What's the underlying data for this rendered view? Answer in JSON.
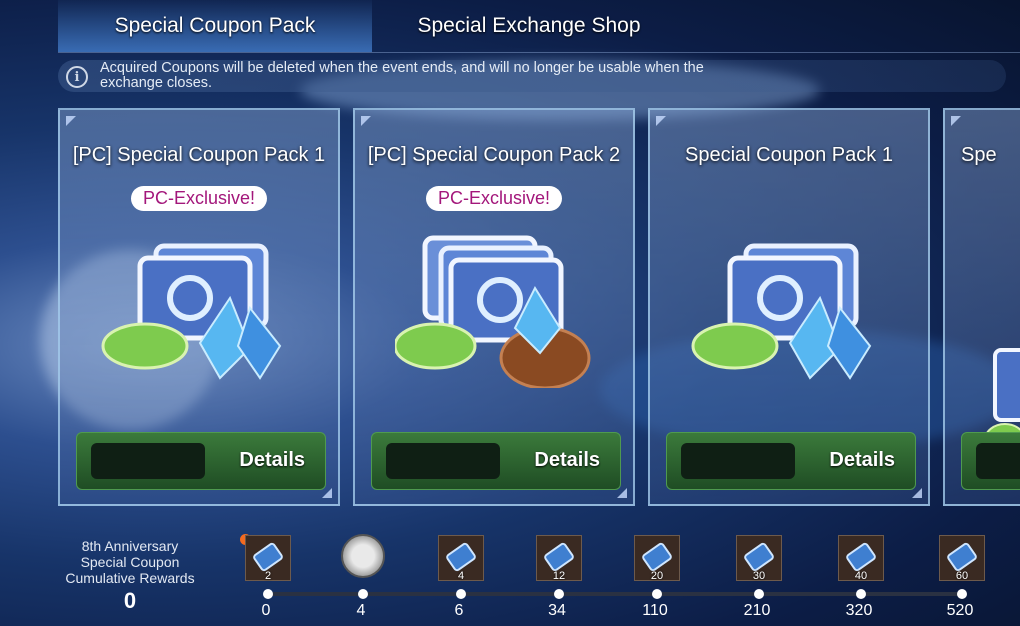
{
  "tabs": [
    {
      "label": "Special Coupon Pack",
      "active": true
    },
    {
      "label": "Special Exchange Shop",
      "active": false
    }
  ],
  "notice": {
    "icon": "info-icon",
    "text": "Acquired Coupons will be deleted when the event ends, and will no longer be usable when the exchange closes."
  },
  "cards": [
    {
      "title": "[PC] Special Coupon Pack 1",
      "badge": "PC-Exclusive!",
      "button": "Details"
    },
    {
      "title": "[PC] Special Coupon Pack 2",
      "badge": "PC-Exclusive!",
      "button": "Details"
    },
    {
      "title": "Special Coupon Pack 1",
      "badge": "",
      "button": "Details"
    },
    {
      "title": "Spe",
      "badge": "",
      "button": ""
    }
  ],
  "rewards": {
    "title": "8th Anniversary Special Coupon Cumulative Rewards",
    "total": "0",
    "milestones": [
      {
        "value": "0",
        "qty": "2",
        "icon": "coupon-ticket-icon"
      },
      {
        "value": "4",
        "qty": "",
        "icon": "medal-icon"
      },
      {
        "value": "6",
        "qty": "4",
        "icon": "coupon-ticket-icon"
      },
      {
        "value": "34",
        "qty": "12",
        "icon": "coupon-ticket-icon"
      },
      {
        "value": "110",
        "qty": "20",
        "icon": "coupon-ticket-icon"
      },
      {
        "value": "210",
        "qty": "30",
        "icon": "coupon-ticket-icon"
      },
      {
        "value": "320",
        "qty": "40",
        "icon": "coupon-ticket-icon"
      },
      {
        "value": "520",
        "qty": "60",
        "icon": "coupon-ticket-icon"
      }
    ]
  },
  "colors": {
    "accent": "#a3177b",
    "button": "#2f6a30",
    "notification": "#f36b21"
  }
}
